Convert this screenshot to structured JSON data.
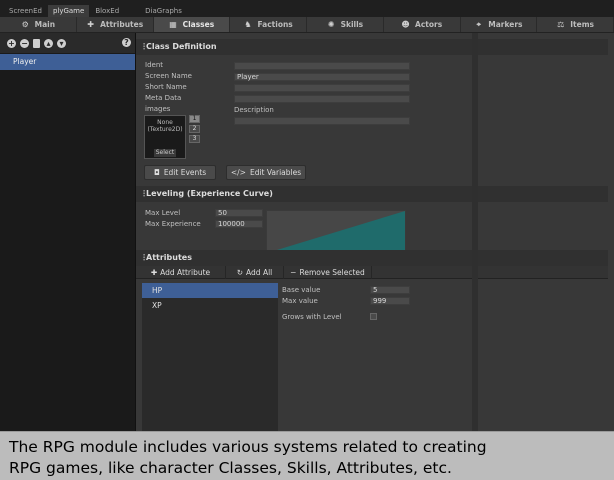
{
  "editor_tabs": [
    "ScreenEd",
    "plyGame",
    "BloxEd",
    "DiaGraphs"
  ],
  "module_tabs": [
    {
      "label": "Main",
      "icon": "gear-icon",
      "glyph": "⚙"
    },
    {
      "label": "Attributes",
      "icon": "plus-icon",
      "glyph": "✚"
    },
    {
      "label": "Classes",
      "icon": "classes-icon",
      "glyph": "▦"
    },
    {
      "label": "Factions",
      "icon": "factions-icon",
      "glyph": "♞"
    },
    {
      "label": "Skills",
      "icon": "skills-icon",
      "glyph": "✺"
    },
    {
      "label": "Actors",
      "icon": "actors-icon",
      "glyph": "☻"
    },
    {
      "label": "Markers",
      "icon": "markers-icon",
      "glyph": "⌖"
    },
    {
      "label": "Items",
      "icon": "items-icon",
      "glyph": "⚖"
    }
  ],
  "active_module": "Classes",
  "class_list": [
    "Player"
  ],
  "class_definition": {
    "title": "Class Definition",
    "ident_label": "Ident",
    "ident_value": "",
    "screen_name_label": "Screen Name",
    "screen_name_value": "Player",
    "short_name_label": "Short Name",
    "short_name_value": "",
    "meta_data_label": "Meta Data",
    "meta_data_value": "",
    "images_label": "images",
    "image_none": "None",
    "image_type": "(Texture2D)",
    "image_select": "Select",
    "image_slots": [
      "1",
      "2",
      "3"
    ],
    "description_label": "Description",
    "description_value": "",
    "edit_events": "Edit Events",
    "edit_variables": "Edit Variables"
  },
  "leveling": {
    "title": "Leveling (Experience Curve)",
    "max_level_label": "Max Level",
    "max_level_value": "50",
    "max_experience_label": "Max Experience",
    "max_experience_value": "100000"
  },
  "attributes": {
    "title": "Attributes",
    "add_attribute": "Add Attribute",
    "add_all": "Add All",
    "remove_selected": "Remove Selected",
    "items": [
      "HP",
      "XP"
    ],
    "selected": "HP",
    "base_value_label": "Base value",
    "base_value": "5",
    "max_value_label": "Max value",
    "max_value": "999",
    "grows_with_level_label": "Grows with Level",
    "grows_with_level": false
  },
  "colors": {
    "selection": "#3e5f96",
    "curve_fill": "#1f6b6b"
  },
  "caption": {
    "line1": "The RPG module includes various systems related to creating",
    "line2": "RPG games, like character Classes, Skills, Attributes, etc."
  }
}
